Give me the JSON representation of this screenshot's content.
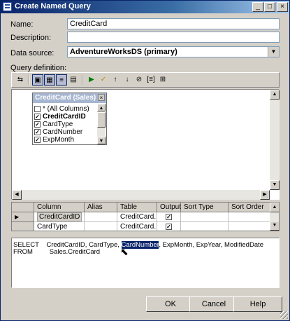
{
  "window": {
    "title": "Create Named Query",
    "controls": [
      "_",
      "□",
      "×"
    ]
  },
  "form": {
    "name_label": "Name:",
    "name_value": "CreditCard",
    "description_label": "Description:",
    "description_value": "",
    "datasource_label": "Data source:",
    "datasource_value": "AdventureWorksDS (primary)",
    "query_definition_label": "Query definition:"
  },
  "toolbar": {
    "icons": [
      "manage-relationships-icon",
      "show-diagram-pane-icon",
      "show-grid-pane-icon",
      "show-sql-pane-icon",
      "show-results-pane-icon",
      "run-icon",
      "verify-sql-icon",
      "sort-ascending-icon",
      "sort-descending-icon",
      "remove-filter-icon",
      "use-group-by-icon",
      "add-table-icon"
    ]
  },
  "diagram": {
    "table_title": "CreditCard (Sales)",
    "columns": [
      {
        "label": "* (All Columns)",
        "checked": false,
        "bold": false
      },
      {
        "label": "CreditCardID",
        "checked": true,
        "bold": true
      },
      {
        "label": "CardType",
        "checked": true,
        "bold": false
      },
      {
        "label": "CardNumber",
        "checked": true,
        "bold": false
      },
      {
        "label": "ExpMonth",
        "checked": true,
        "bold": false
      }
    ]
  },
  "grid": {
    "headers": [
      "Column",
      "Alias",
      "Table",
      "Output",
      "Sort Type",
      "Sort Order"
    ],
    "rows": [
      {
        "column": "CreditCardID",
        "alias": "",
        "table": "CreditCard...",
        "output": true
      },
      {
        "column": "CardType",
        "alias": "",
        "table": "CreditCard...",
        "output": true
      }
    ]
  },
  "sql": {
    "line1_keyword": "SELECT",
    "line1_before": "CreditCardID, CardType, ",
    "line1_selected": "CardNumber",
    "line1_after": ", ExpMonth, ExpYear, ModifiedDate",
    "line2_keyword": "FROM",
    "line2_text": "Sales.CreditCard"
  },
  "buttons": {
    "ok": "OK",
    "cancel": "Cancel",
    "help": "Help"
  }
}
